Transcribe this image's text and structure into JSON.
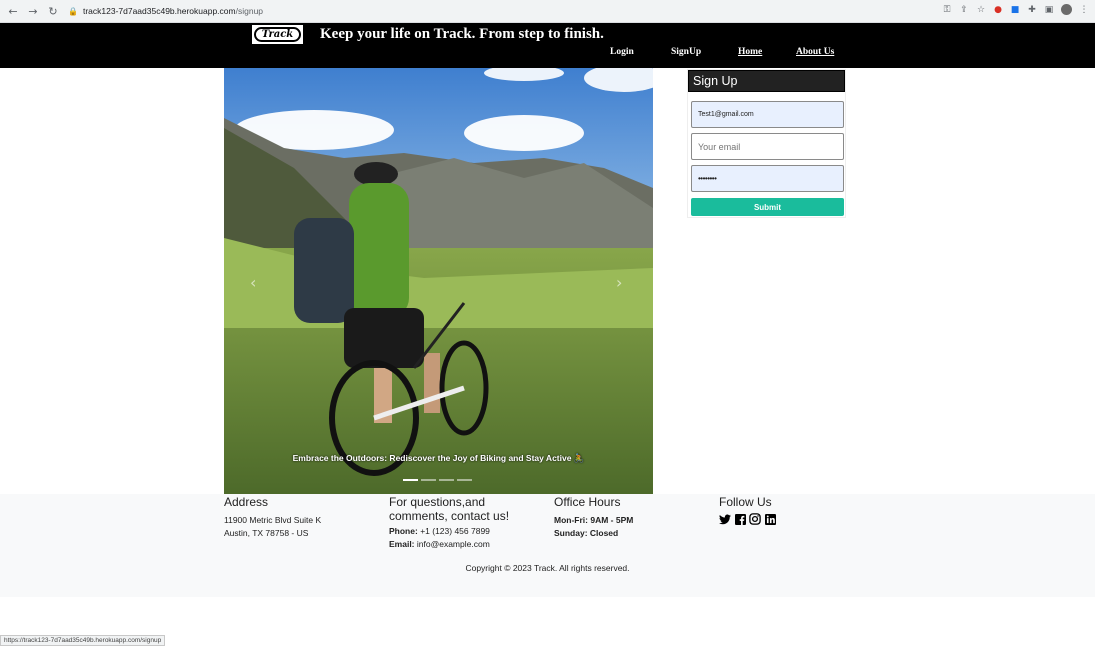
{
  "browser": {
    "url_host": "track123-7d7aad35c49b.herokuapp.com",
    "url_path": "/signup",
    "status_url": "https://track123-7d7aad35c49b.herokuapp.com/signup"
  },
  "header": {
    "logo_text": "Track",
    "tagline": "Keep your life on Track. From step to finish.",
    "nav": [
      "Login",
      "SignUp",
      "Home",
      "About Us"
    ]
  },
  "carousel": {
    "caption": "Embrace the Outdoors: Rediscover the Joy of Biking and Stay Active 🚴",
    "slides": 4,
    "active_slide": 1
  },
  "signup": {
    "title": "Sign Up",
    "username_value": "Test1@gmail.com",
    "email_placeholder": "Your email",
    "password_value": "••••••••",
    "submit_label": "Submit"
  },
  "footer": {
    "address": {
      "heading": "Address",
      "line1": "11900 Metric Blvd Suite K",
      "line2": "Austin, TX 78758 - US"
    },
    "contact": {
      "heading": "For questions,and comments, contact us!",
      "phone_label": "Phone:",
      "phone": "+1 (123) 456 7899",
      "email_label": "Email:",
      "email": "info@example.com"
    },
    "hours": {
      "heading": "Office Hours",
      "weekday": "Mon-Fri: 9AM - 5PM",
      "sunday": "Sunday: Closed"
    },
    "follow": {
      "heading": "Follow Us",
      "icons": [
        "twitter-icon",
        "facebook-icon",
        "instagram-icon",
        "linkedin-icon"
      ]
    },
    "copyright": "Copyright © 2023 Track. All rights reserved."
  },
  "colors": {
    "header_bg": "#000000",
    "submit_bg": "#1abc9c",
    "autofill_bg": "#e8f0fe",
    "footer_bg": "#f8f9fa"
  }
}
